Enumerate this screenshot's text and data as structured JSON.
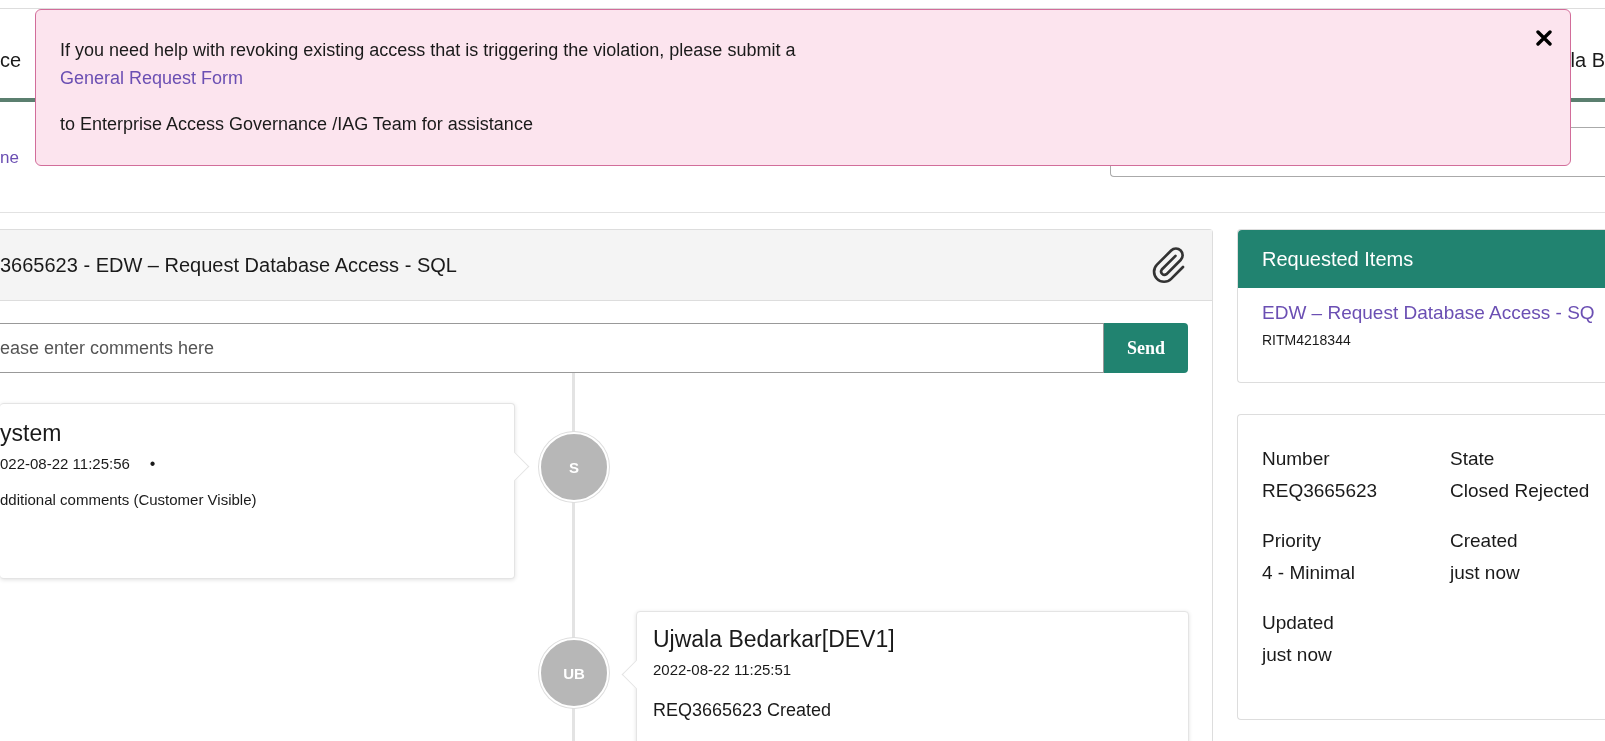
{
  "header": {
    "left_text": "ce",
    "right_text": "la B"
  },
  "alert": {
    "text": "If you need help with revoking existing access that is triggering the violation, please submit a",
    "link": "General Request Form",
    "text_after": "to Enterprise Access Governance /IAG Team for assistance"
  },
  "breadcrumb": {
    "link": "ne"
  },
  "ticket": {
    "title": "3665623 - EDW – Request Database Access - SQL",
    "comment_placeholder": "ease enter comments here",
    "send": "Send"
  },
  "activity": [
    {
      "kind": "left",
      "author": "ystem",
      "time": "022-08-22 11:25:56",
      "separator": "•",
      "body": "dditional comments (Customer Visible)",
      "avatar": "S"
    },
    {
      "kind": "right",
      "author": "Ujwala Bedarkar[DEV1]",
      "time": "2022-08-22 11:25:51",
      "body": "REQ3665623 Created",
      "avatar": "UB"
    }
  ],
  "requested_items": {
    "title": "Requested Items",
    "items": [
      {
        "name": "EDW – Request Database Access - SQ",
        "number": "RITM4218344"
      }
    ]
  },
  "details": [
    {
      "label": "Number",
      "value": "REQ3665623"
    },
    {
      "label": "State",
      "value": "Closed Rejected"
    },
    {
      "label": "Priority",
      "value": "4 - Minimal"
    },
    {
      "label": "Created",
      "value": "just now"
    },
    {
      "label": "Updated",
      "value": "just now"
    }
  ]
}
